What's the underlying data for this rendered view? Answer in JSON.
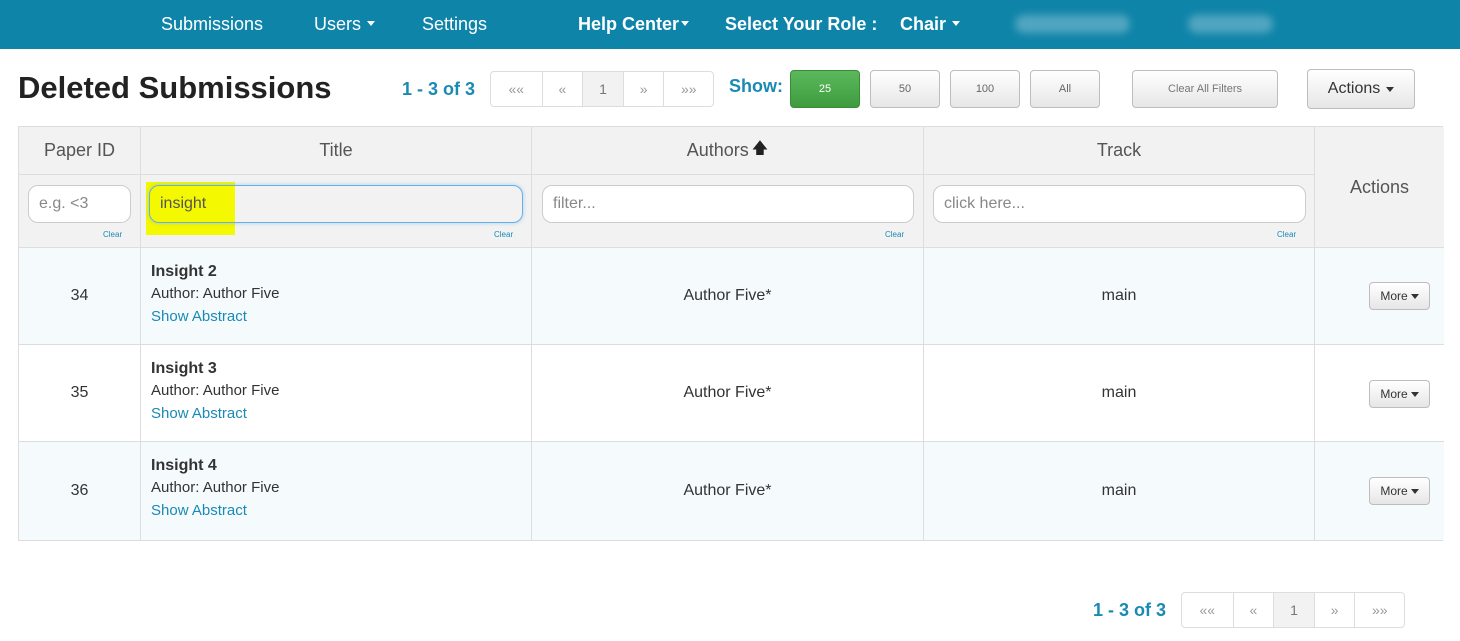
{
  "nav": {
    "items": [
      "Submissions",
      "Users",
      "Settings"
    ],
    "help_center": "Help Center",
    "role_label": "Select Your Role :",
    "role_value": "Chair"
  },
  "page": {
    "title": "Deleted Submissions"
  },
  "pagination": {
    "summary": "1 - 3 of 3",
    "buttons": [
      "««",
      "«",
      "1",
      "»",
      "»»"
    ],
    "current_page": "1"
  },
  "show": {
    "label": "Show:",
    "options": [
      "25",
      "50",
      "100",
      "All"
    ],
    "selected": "25"
  },
  "toolbar": {
    "clear_filters": "Clear All Filters",
    "actions": "Actions"
  },
  "table": {
    "headers": {
      "paper_id": "Paper ID",
      "title": "Title",
      "authors": "Authors",
      "track": "Track",
      "actions": "Actions"
    },
    "sort_indicator": "authors ascending",
    "filters": {
      "paper_id_placeholder": "e.g. <3",
      "title_value": "insight",
      "authors_placeholder": "filter...",
      "track_placeholder": "click here...",
      "clear_label": "Clear"
    },
    "rows": [
      {
        "id": "34",
        "title": "Insight 2",
        "author_label": "Author:",
        "author_name": "Author Five",
        "abstract_link": "Show Abstract",
        "authors": "Author Five*",
        "track": "main",
        "more": "More"
      },
      {
        "id": "35",
        "title": "Insight 3",
        "author_label": "Author:",
        "author_name": "Author Five",
        "abstract_link": "Show Abstract",
        "authors": "Author Five*",
        "track": "main",
        "more": "More"
      },
      {
        "id": "36",
        "title": "Insight 4",
        "author_label": "Author:",
        "author_name": "Author Five",
        "abstract_link": "Show Abstract",
        "authors": "Author Five*",
        "track": "main",
        "more": "More"
      }
    ]
  },
  "colors": {
    "nav_bg": "#0f84a9",
    "accent": "#1a8ab4",
    "active_green": "#5cb85c",
    "search_highlight": "#f4f800"
  }
}
